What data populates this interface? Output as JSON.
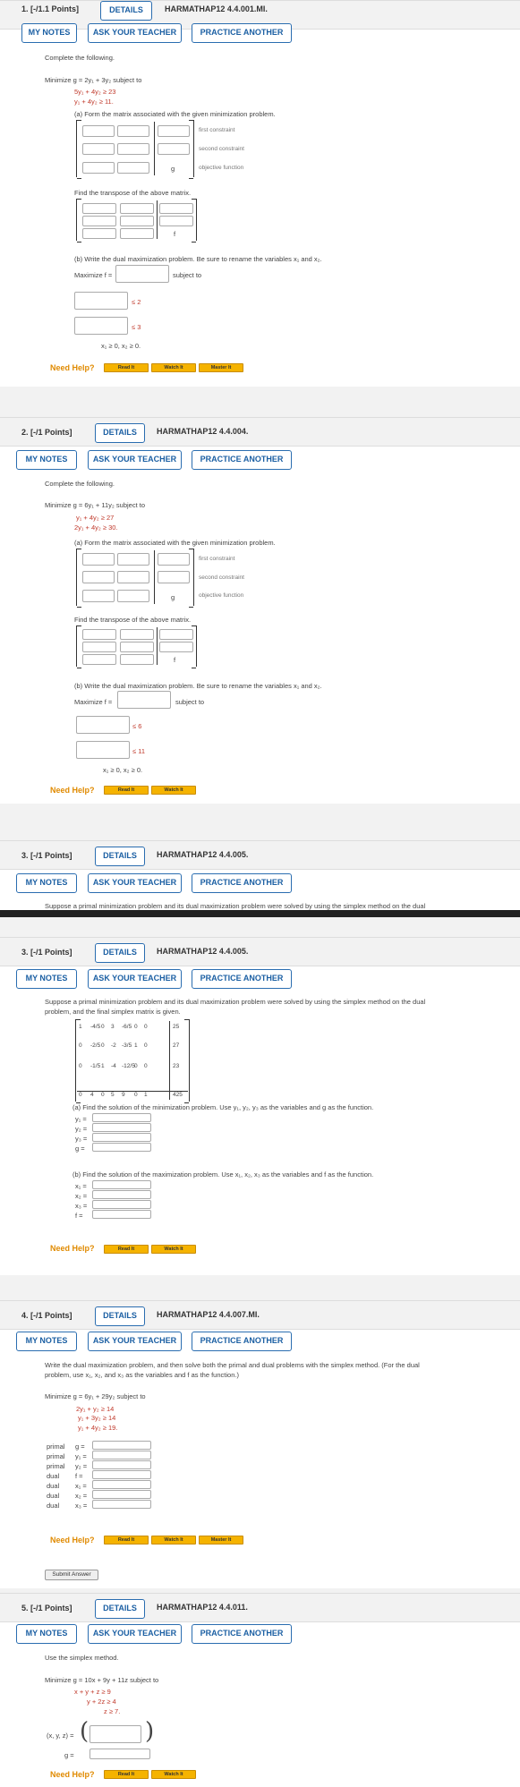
{
  "common": {
    "details": "DETAILS",
    "my_notes": "MY NOTES",
    "ask_teacher": "ASK YOUR TEACHER",
    "practice": "PRACTICE ANOTHER",
    "need_help": "Need Help?",
    "read_it": "Read It",
    "watch_it": "Watch It",
    "master_it": "Master It",
    "submit": "Submit Answer",
    "first_constraint": "first constraint",
    "second_constraint": "second constraint",
    "objective_function": "objective function",
    "g": "g",
    "f": "f",
    "subject_to": "subject to",
    "transpose_prompt": "Find the transpose of the above matrix."
  },
  "q1": {
    "number": "1. [-/1.1 Points]",
    "code": "HARMATHAP12 4.4.001.MI.",
    "intro": "Complete the following.",
    "minimize": "Minimize  g = 2y₁ + 3y₂  subject to",
    "c1": "5y₁ + 4y₂ ≥ 23",
    "c2": "y₁ + 4y₂ ≥ 11.",
    "part_a": "(a) Form the matrix associated with the given minimization problem.",
    "part_b": "(b) Write the dual maximization problem. Be sure to rename the variables  x₁  and  x₂.",
    "maximize": "Maximize f =",
    "le1": "≤ 2",
    "le2": "≤ 3",
    "nonneg": "x₁ ≥ 0, x₂ ≥ 0."
  },
  "q2": {
    "number": "2. [-/1 Points]",
    "code": "HARMATHAP12 4.4.004.",
    "intro": "Complete the following.",
    "minimize": "Minimize  g = 6y₁ + 11y₂  subject to",
    "c1": "y₁ + 4y₂ ≥ 27",
    "c2": "2y₁ + 4y₂ ≥ 30.",
    "part_a": "(a) Form the matrix associated with the given minimization problem.",
    "part_b": "(b) Write the dual maximization problem. Be sure to rename the variables  x₁  and  x₂.",
    "maximize": "Maximize f =",
    "le1": "≤  6",
    "le2": "≤ 11",
    "nonneg": "x₁ ≥ 0, x₂ ≥  0."
  },
  "q3_clip": {
    "number": "3. [-/1 Points]",
    "code": "HARMATHAP12 4.4.005.",
    "text": "Suppose a primal minimization problem and its dual maximization problem were solved by using the simplex method on the dual"
  },
  "q3": {
    "number": "3. [-/1 Points]",
    "code": "HARMATHAP12 4.4.005.",
    "intro1": "Suppose a primal minimization problem and its dual maximization problem were solved by using the simplex method on the dual",
    "intro2": "problem, and the final simplex matrix is given.",
    "matrix": [
      [
        "1",
        "-4/5",
        "0",
        "3",
        "-6/5",
        "0",
        "0",
        "25"
      ],
      [
        "0",
        "-2/5",
        "0",
        "-2",
        "-3/5",
        "1",
        "0",
        "27"
      ],
      [
        "0",
        "-1/5",
        "1",
        "-4",
        "-12/5",
        "0",
        "0",
        "23"
      ],
      [
        "0",
        "4",
        "0",
        "5",
        "9",
        "0",
        "1",
        "425"
      ]
    ],
    "part_a": "(a) Find the solution of the minimization problem. Use y₁, y₂, y₃ as the variables and g as the function.",
    "vars_a": [
      "y₁ =",
      "y₂ =",
      "y₃ =",
      "g ="
    ],
    "part_b": "(b) Find the solution of the maximization problem. Use x₁, x₂, x₃ as the variables and f as the function.",
    "vars_b": [
      "x₁ =",
      "x₂ =",
      "x₃ =",
      "f ="
    ]
  },
  "q4": {
    "number": "4. [-/1 Points]",
    "code": "HARMATHAP12 4.4.007.MI.",
    "intro1": "Write the dual maximization problem, and then solve both the primal and dual problems with the simplex method. (For the dual",
    "intro2": "problem, use x₁, x₂, and x₃ as the variables and f as the function.)",
    "minimize": "Minimize  g = 6y₁ + 29y₂  subject to",
    "c1": "2y₁ +   y₂ ≥ 14",
    "c2": "y₁ + 3y₂ ≥ 14",
    "c3": "y₁ +  4y₂ ≥ 19.",
    "rows": [
      {
        "kind": "primal",
        "var": "g ="
      },
      {
        "kind": "primal",
        "var": "y₁ ="
      },
      {
        "kind": "primal",
        "var": "y₂ ="
      },
      {
        "kind": "dual",
        "var": "f ="
      },
      {
        "kind": "dual",
        "var": "x₁ ="
      },
      {
        "kind": "dual",
        "var": "x₂ ="
      },
      {
        "kind": "dual",
        "var": "x₃ ="
      }
    ]
  },
  "q5": {
    "number": "5. [-/1 Points]",
    "code": "HARMATHAP12 4.4.011.",
    "intro": "Use the simplex method.",
    "minimize": "Minimize  g = 10x + 9y + 11z  subject to",
    "c1": "x +  y +   z ≥ 9",
    "c2": "y + 2z ≥ 4",
    "c3": "z ≥ 7.",
    "tuple": "(x, y, z) =",
    "g": "g ="
  }
}
